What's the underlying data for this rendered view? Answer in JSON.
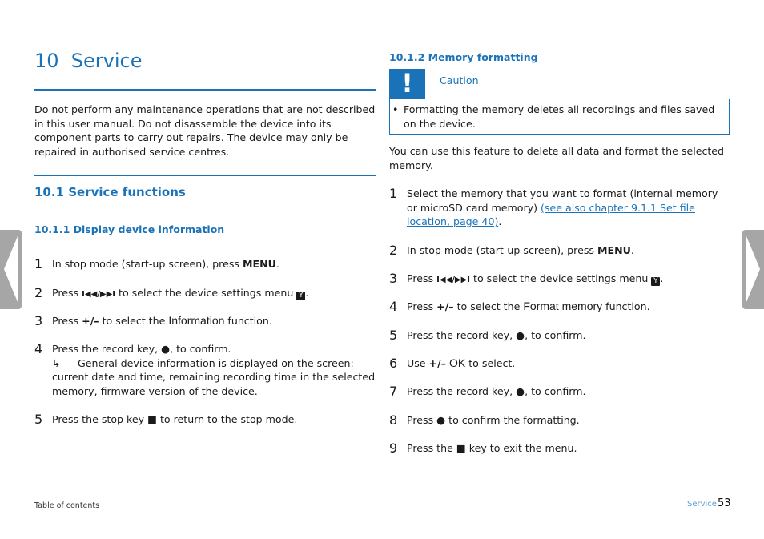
{
  "chapter": {
    "title": "10  Service",
    "intro": "Do not perform any maintenance operations that are not described in this user manual. Do not disassemble the device into its component parts to carry out repairs. The device may only be repaired in authorised service centres."
  },
  "section": {
    "title": "10.1 Service functions"
  },
  "display_info": {
    "title": "10.1.1 Display device information",
    "steps": [
      {
        "num": "1",
        "pre": "In stop mode (start-up screen), press ",
        "key": "MENU",
        "post": "."
      },
      {
        "num": "2",
        "pre": "Press ",
        "key": "I◀◀/▶▶I",
        "post": " to select the device settings menu ",
        "icon": "Y",
        "post2": "."
      },
      {
        "num": "3",
        "pre": "Press ",
        "key": "+/–",
        "mid": " to select the ",
        "func": "Information",
        "post": " function."
      },
      {
        "num": "4",
        "pre": "Press the record key, ",
        "symbol": "●",
        "post": ", to confirm.",
        "result_arrow": "↳",
        "result": "General device information is displayed on the screen: current date and time, remaining recording time in the selected memory, firmware version of the device."
      },
      {
        "num": "5",
        "pre": "Press the stop key ",
        "symbol": "■",
        "post": " to return to the stop mode."
      }
    ]
  },
  "memory_format": {
    "title": "10.1.2 Memory formatting",
    "caution": {
      "badge": "!",
      "label": "Caution",
      "bullet": "•",
      "text": "Formatting the memory deletes all recordings and files saved on the device."
    },
    "intro": "You can use this feature to delete all data and format the selected memory.",
    "steps": [
      {
        "num": "1",
        "pre": "Select the memory that you want to format (internal memory or microSD card memory) ",
        "link": "(see also chapter 9.1.1 Set file location, page 40)",
        "post": "."
      },
      {
        "num": "2",
        "pre": "In stop mode (start-up screen), press ",
        "key": "MENU",
        "post": "."
      },
      {
        "num": "3",
        "pre": "Press ",
        "key": "I◀◀/▶▶I",
        "post": " to select the device settings menu ",
        "icon": "Y",
        "post2": "."
      },
      {
        "num": "4",
        "pre": "Press ",
        "key": "+/–",
        "mid": " to select the ",
        "func": "Format memory",
        "post": " function."
      },
      {
        "num": "5",
        "pre": "Press the record key, ",
        "symbol": "●",
        "post": ", to confirm."
      },
      {
        "num": "6",
        "pre": "Use ",
        "key": "+/–",
        "mid": " ",
        "func": "OK",
        "post": " to select."
      },
      {
        "num": "7",
        "pre": "Press the record key, ",
        "symbol": "●",
        "post": ", to confirm."
      },
      {
        "num": "8",
        "pre": "Press ",
        "symbol": "●",
        "post": " to confirm the formatting."
      },
      {
        "num": "9",
        "pre": "Press the ",
        "symbol": "■",
        "post": " key to exit the menu."
      }
    ]
  },
  "footer": {
    "toc_link": "Table of contents",
    "section": "Service",
    "page": "53"
  },
  "colors": {
    "accent": "#1a73b8",
    "nav_arrow": "#a6a6a6"
  }
}
